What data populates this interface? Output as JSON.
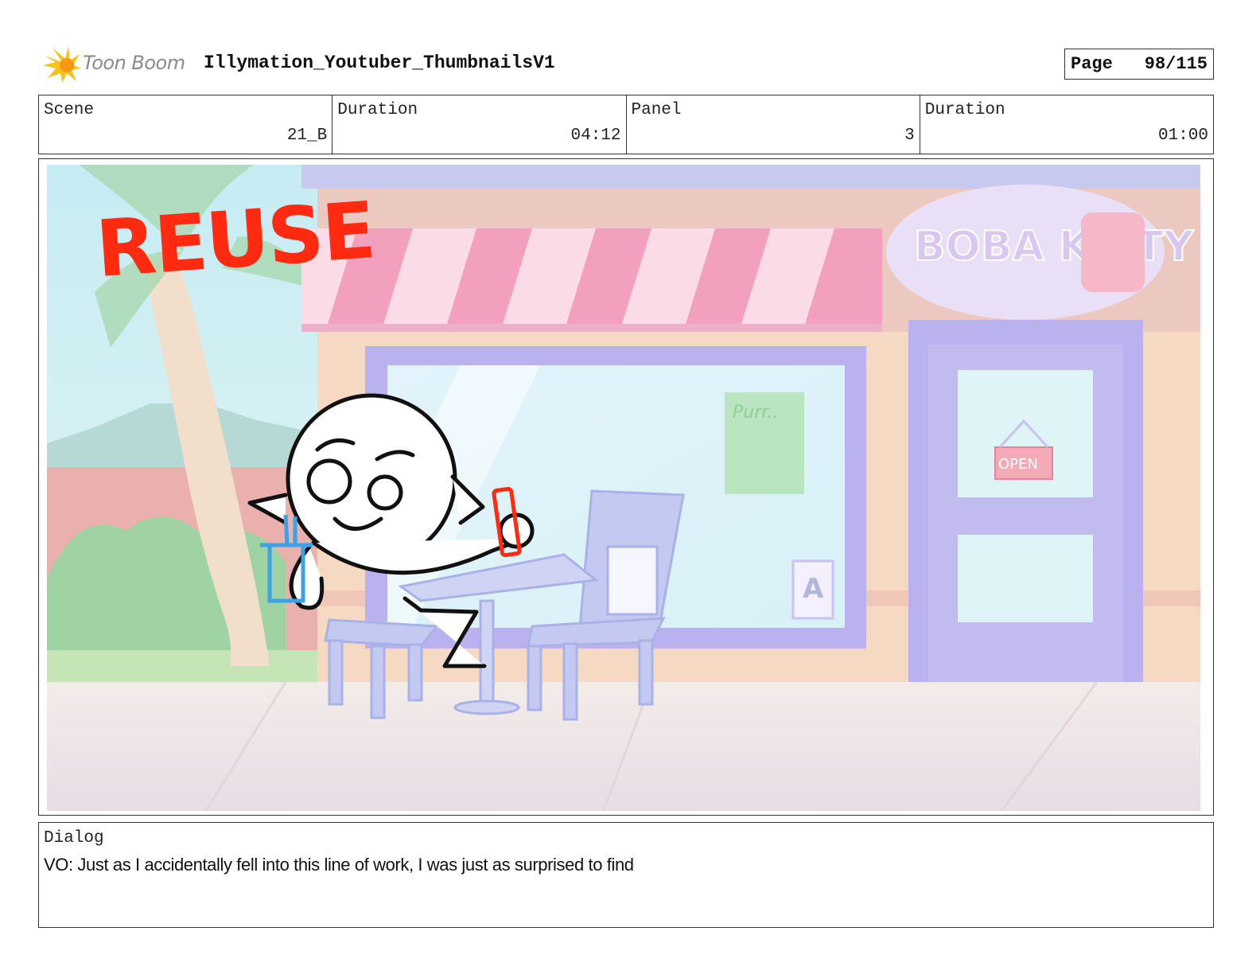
{
  "header": {
    "logo_text": "Toon Boom",
    "document_title": "Illymation_Youtuber_ThumbnailsV1",
    "page_label": "Page",
    "page_value": "98/115"
  },
  "info": {
    "scene_label": "Scene",
    "scene_value": "21_B",
    "scene_duration_label": "Duration",
    "scene_duration_value": "04:12",
    "panel_label": "Panel",
    "panel_value": "3",
    "panel_duration_label": "Duration",
    "panel_duration_value": "01:00"
  },
  "panel_image": {
    "overlay_text": "REUSE",
    "shop_sign": "BOBA KITTY",
    "poster_text": "Purr..",
    "door_sign": "OPEN",
    "menu_board_letter": "A"
  },
  "dialog": {
    "label": "Dialog",
    "text": "VO: Just as I accidentally fell into this line of work, I was just as surprised to find"
  },
  "colors": {
    "reuse_red": "#ff2a0f",
    "awning_pink": "#f2a0be",
    "storefront_purple": "#b9b2ee",
    "border": "#333333"
  }
}
